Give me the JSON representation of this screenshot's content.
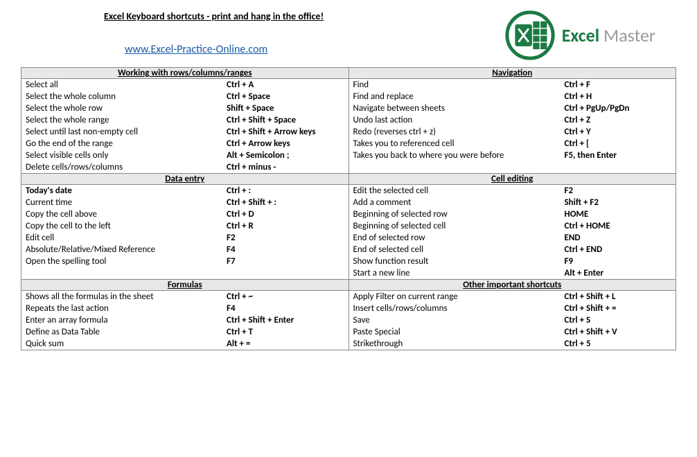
{
  "header": {
    "title": "Excel Keyboard shortcuts - print and hang in the office!",
    "link": "www.Excel-Practice-Online.com",
    "logo": {
      "text1": "Excel",
      "text2": " Master"
    }
  },
  "sections": {
    "r1c1": {
      "title": "Working with rows/columns/ranges",
      "items": [
        {
          "desc": "Select all",
          "key": "Ctrl + A"
        },
        {
          "desc": "Select the whole column",
          "key": "Ctrl + Space"
        },
        {
          "desc": "Select the whole row",
          "key": "Shift + Space"
        },
        {
          "desc": "Select the whole range",
          "key": "Ctrl + Shift + Space"
        },
        {
          "desc": "Select until last non-empty cell",
          "key": "Ctrl + Shift + Arrow keys"
        },
        {
          "desc": "Go the end of the range",
          "key": "Ctrl + Arrow keys"
        },
        {
          "desc": "Select visible cells only",
          "key": "Alt + Semicolon ;"
        },
        {
          "desc": "Delete cells/rows/columns",
          "key": "Ctrl + minus -"
        }
      ]
    },
    "r1c2": {
      "title": "Navigation",
      "items": [
        {
          "desc": "Find",
          "key": "Ctrl + F"
        },
        {
          "desc": "Find and replace",
          "key": "Ctrl + H"
        },
        {
          "desc": "Navigate between sheets",
          "key": " Ctrl + PgUp/PgDn"
        },
        {
          "desc": "Undo last action",
          "key": "Ctrl + Z"
        },
        {
          "desc": "Redo (reverses ctrl + z)",
          "key": "Ctrl + Y"
        },
        {
          "desc": "Takes you to referenced cell",
          "key": "Ctrl + ["
        },
        {
          "desc": "Takes you back to where you were before",
          "key": "F5, then Enter"
        }
      ]
    },
    "r2c1": {
      "title": "Data entry",
      "items": [
        {
          "desc": "Today's date",
          "key": "Ctrl + :",
          "bold": true
        },
        {
          "desc": "Current time",
          "key": "Ctrl + Shift + :"
        },
        {
          "desc": "Copy the cell above",
          "key": "Ctrl + D"
        },
        {
          "desc": "Copy the cell to the left",
          "key": "Ctrl + R"
        },
        {
          "desc": "Edit cell",
          "key": "F2"
        },
        {
          "desc": "Absolute/Relative/Mixed Reference",
          "key": "F4"
        },
        {
          "desc": "Open the spelling tool",
          "key": "F7"
        }
      ]
    },
    "r2c2": {
      "title": "Cell editing",
      "items": [
        {
          "desc": "Edit the selected cell",
          "key": "F2"
        },
        {
          "desc": "Add a comment",
          "key": "Shift + F2"
        },
        {
          "desc": "Beginning of selected row",
          "key": "HOME"
        },
        {
          "desc": "Beginning of selected cell",
          "key": "Ctrl + HOME"
        },
        {
          "desc": "End of selected row",
          "key": "END"
        },
        {
          "desc": "End of selected cell",
          "key": "Ctrl + END"
        },
        {
          "desc": "Show function result",
          "key": "F9"
        },
        {
          "desc": "Start a new line",
          "key": "Alt + Enter"
        }
      ]
    },
    "r3c1": {
      "title": "Formulas",
      "items": [
        {
          "desc": "Shows all the formulas in the sheet",
          "key": "Ctrl + ~"
        },
        {
          "desc": "Repeats the last action",
          "key": "F4"
        },
        {
          "desc": "Enter an array formula",
          "key": "Ctrl + Shift + Enter"
        },
        {
          "desc": "Define as Data Table",
          "key": "Ctrl + T"
        },
        {
          "desc": "Quick sum",
          "key": "Alt + ="
        }
      ]
    },
    "r3c2": {
      "title": "Other important shortcuts",
      "items": [
        {
          "desc": "Apply Filter on current range",
          "key": "Ctrl + Shift + L"
        },
        {
          "desc": "Insert cells/rows/columns",
          "key": "Ctrl + Shift + ="
        },
        {
          "desc": "Save",
          "key": "Ctrl + S"
        },
        {
          "desc": "Paste Special",
          "key": "Ctrl + Shift + V"
        },
        {
          "desc": "Strikethrough",
          "key": "Ctrl + 5"
        }
      ]
    }
  }
}
